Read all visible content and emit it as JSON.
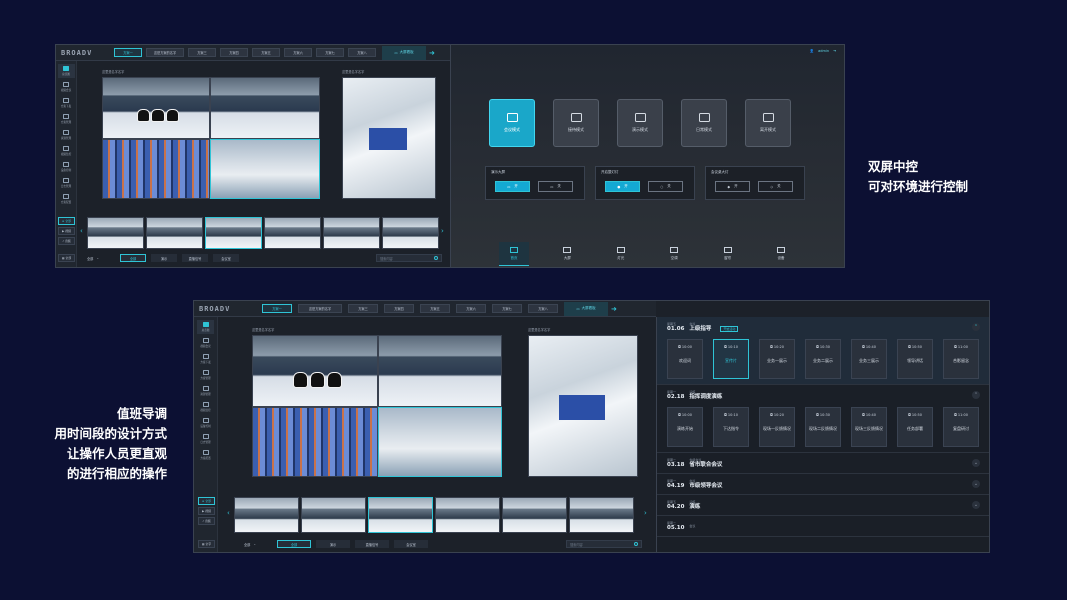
{
  "captions": {
    "top": [
      "双屏中控",
      "可对环境进行控制"
    ],
    "bottom": [
      "值班导调",
      "用时间段的设计方式",
      "让操作人员更直观",
      "的进行相应的操作"
    ]
  },
  "app": {
    "logo": "BROADV",
    "big_screen": "大屏看板",
    "user": "admin"
  },
  "top_screen": {
    "tabs": [
      "方案一",
      "这是方案的名字",
      "方案三",
      "方案四",
      "方案五",
      "方案六",
      "方案七",
      "方案八"
    ],
    "sidebar": [
      "总览图",
      "视频会议",
      "方案下发",
      "方案管理",
      "资源管理",
      "视频监控",
      "设备控制",
      "日志管理",
      "方案配置"
    ],
    "video_label_left": "这里是名字名字",
    "video_label_right": "这里是名字名字",
    "left_controls": [
      "全部",
      "视频",
      "音频"
    ],
    "bottom_controls": {
      "select": "全部",
      "buttons": [
        "全部",
        "演示",
        "直播信号",
        "会议室"
      ],
      "all_btn": "全部"
    },
    "search_placeholder": "搜索内容",
    "modes": [
      "会议模式",
      "接待模式",
      "演示模式",
      "日常模式",
      "离开模式"
    ],
    "switch_cards": [
      {
        "title": "演示大屏",
        "on": "开",
        "off": "关"
      },
      {
        "title": "开启整灯灯",
        "on": "开",
        "off": "关"
      },
      {
        "title": "会议桌大灯",
        "on": "开",
        "off": "关"
      }
    ],
    "bottom_nav": [
      "首页",
      "大屏",
      "灯光",
      "空调",
      "窗帘",
      "设备"
    ]
  },
  "bottom_screen": {
    "tabs": [
      "方案一",
      "这是方案的名字",
      "方案三",
      "方案四",
      "方案五",
      "方案六",
      "方案七",
      "方案八"
    ],
    "sidebar": [
      "总览图",
      "视频会议",
      "方案下发",
      "方案管理",
      "资源管理",
      "视频监控",
      "设备控制",
      "日志管理",
      "方案配置"
    ],
    "video_label_left": "这里是名字名字",
    "video_label_right": "这里是名字名字",
    "left_controls": [
      "全部",
      "视频",
      "音频",
      "全字"
    ],
    "bottom_controls": {
      "select": "全部",
      "buttons": [
        "全部",
        "演示",
        "直播信号",
        "会议室"
      ]
    },
    "search_placeholder": "搜索内容",
    "schedule": [
      {
        "weekday": "星期五",
        "date": "01.06",
        "tag": "会议",
        "title": "上级指导",
        "badge": "开始活动",
        "expanded": true,
        "items": [
          {
            "time": "10:00",
            "label": "欢迎词"
          },
          {
            "time": "10:10",
            "label": "宣传片"
          },
          {
            "time": "10:20",
            "label": "业务一展示"
          },
          {
            "time": "10:30",
            "label": "业务二展示"
          },
          {
            "time": "10:40",
            "label": "业务三展示"
          },
          {
            "time": "10:50",
            "label": "领导讲话"
          },
          {
            "time": "11:00",
            "label": "合影留念"
          }
        ]
      },
      {
        "weekday": "星期一",
        "date": "02.18",
        "tag": "演练",
        "title": "指挥调度演练",
        "expanded": true,
        "items": [
          {
            "time": "10:00",
            "label": "演练开始"
          },
          {
            "time": "10:10",
            "label": "下达指令"
          },
          {
            "time": "10:20",
            "label": "现场一反馈情况"
          },
          {
            "time": "10:30",
            "label": "现场二反馈情况"
          },
          {
            "time": "10:40",
            "label": "现场三反馈情况"
          },
          {
            "time": "10:50",
            "label": "任务部署"
          },
          {
            "time": "11:00",
            "label": "复盘研讨"
          }
        ]
      },
      {
        "weekday": "星期二",
        "date": "03.18",
        "tag": "省级会议",
        "title": "省市联合会议",
        "expanded": false
      },
      {
        "weekday": "星期一",
        "date": "04.19",
        "tag": "会议",
        "title": "市级领导会议",
        "expanded": false
      },
      {
        "weekday": "星期五",
        "date": "04.20",
        "tag": "演练",
        "title": "演练",
        "expanded": false
      },
      {
        "weekday": "星期二",
        "date": "05.10",
        "tag": "会议",
        "title": "",
        "expanded": false
      }
    ]
  },
  "colors": {
    "accent": "#2fc4d6",
    "background": "#0c1033",
    "panel": "#1c2129"
  }
}
